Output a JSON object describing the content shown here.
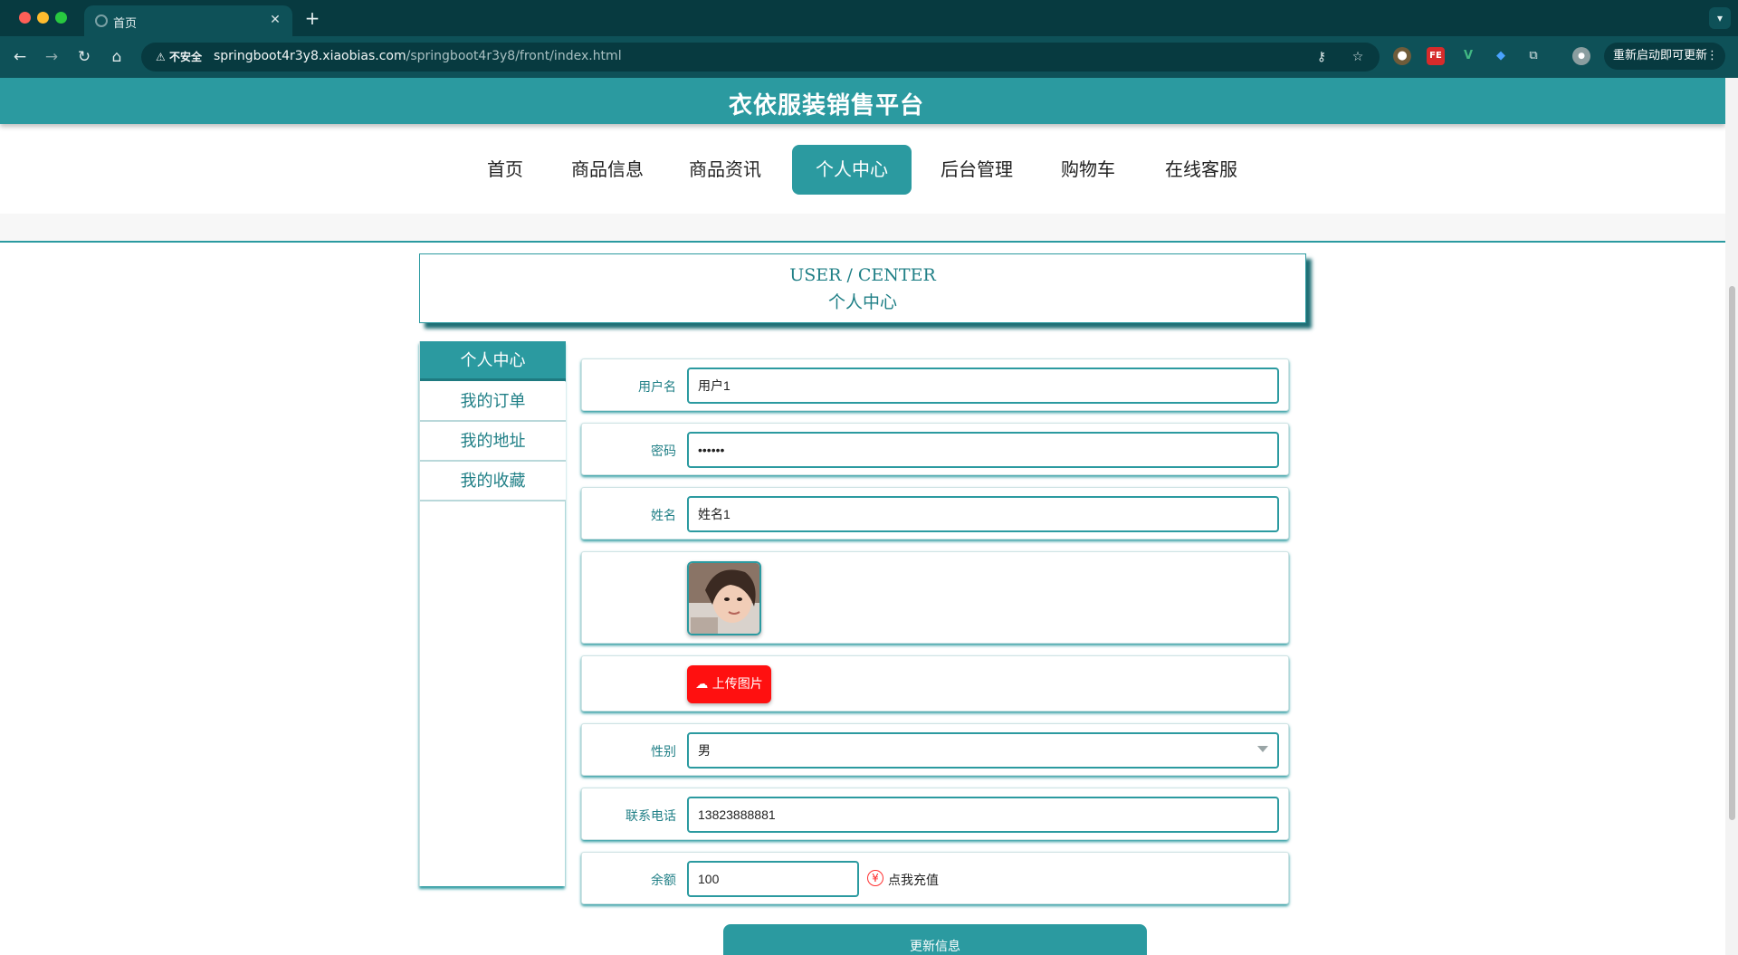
{
  "browser": {
    "tab_title": "首页",
    "tab_close": "✕",
    "new_tab": "+",
    "insecure_label": "不安全",
    "url_host": "springboot4r3y8.xiaobias.com",
    "url_path": "/springboot4r3y8/front/index.html",
    "update_label": "重新启动即可更新"
  },
  "site": {
    "title": "衣依服装销售平台",
    "menu": [
      {
        "label": "首页"
      },
      {
        "label": "商品信息"
      },
      {
        "label": "商品资讯"
      },
      {
        "label": "个人中心"
      },
      {
        "label": "后台管理"
      },
      {
        "label": "购物车"
      },
      {
        "label": "在线客服"
      }
    ],
    "active_menu": "个人中心"
  },
  "user_center": {
    "title_en": "USER / CENTER",
    "title_cn": "个人中心"
  },
  "sidebar": {
    "items": [
      {
        "label": "个人中心"
      },
      {
        "label": "我的订单"
      },
      {
        "label": "我的地址"
      },
      {
        "label": "我的收藏"
      }
    ],
    "active": "个人中心"
  },
  "form": {
    "username": {
      "label": "用户名",
      "value": "用户1"
    },
    "password": {
      "label": "密码",
      "value": "••••••"
    },
    "name": {
      "label": "姓名",
      "value": "姓名1"
    },
    "upload_label": "上传图片",
    "gender": {
      "label": "性别",
      "value": "男"
    },
    "phone": {
      "label": "联系电话",
      "value": "13823888881"
    },
    "balance": {
      "label": "余额",
      "value": "100",
      "recharge_icon": "¥",
      "recharge_label": "点我充值"
    },
    "submit_label": "更新信息"
  },
  "colors": {
    "primary": "#2b9aa0",
    "upload_button": "#ff1010",
    "chrome": "#073a40"
  }
}
